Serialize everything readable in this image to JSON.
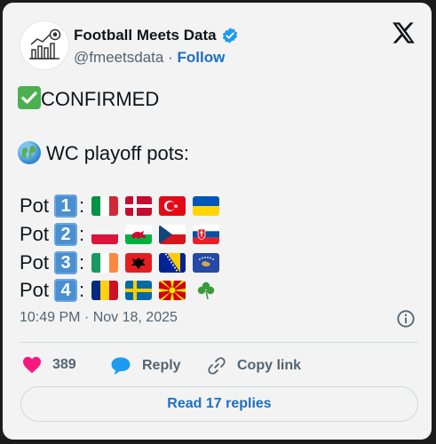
{
  "author": {
    "name": "Football Meets Data",
    "handle": "@fmeetsdata",
    "separator": "·",
    "follow_label": "Follow",
    "verified_icon": "verified-badge-icon",
    "avatar_icon": "chart-football-logo-icon"
  },
  "platform_icon": "x-logo-icon",
  "content": {
    "line1": "CONFIRMED",
    "line1_emoji": "check-mark-button-emoji",
    "line2": "WC playoff pots:",
    "line2_emoji": "globe-emoji",
    "pots": [
      {
        "label": "Pot",
        "number": "1",
        "flags": [
          "Italy",
          "Denmark",
          "Turkey",
          "Ukraine"
        ]
      },
      {
        "label": "Pot",
        "number": "2",
        "flags": [
          "Poland",
          "Wales",
          "Czechia",
          "Slovakia"
        ]
      },
      {
        "label": "Pot",
        "number": "3",
        "flags": [
          "Ireland",
          "Albania",
          "Bosnia and Herzegovina",
          "Kosovo"
        ]
      },
      {
        "label": "Pot",
        "number": "4",
        "flags": [
          "Romania",
          "Sweden",
          "North Macedonia",
          "Shamrock"
        ]
      }
    ],
    "colon": ":"
  },
  "timestamp": "10:49 PM · Nov 18, 2025",
  "info_icon": "info-icon",
  "actions": {
    "like_count": "389",
    "reply_label": "Reply",
    "copy_label": "Copy link"
  },
  "read_replies_label": "Read 17 replies",
  "colors": {
    "accent": "#1d6fbf",
    "like": "#f91880",
    "keycap": "#4a8fd0",
    "text": "#0f1419",
    "muted": "#536471"
  }
}
